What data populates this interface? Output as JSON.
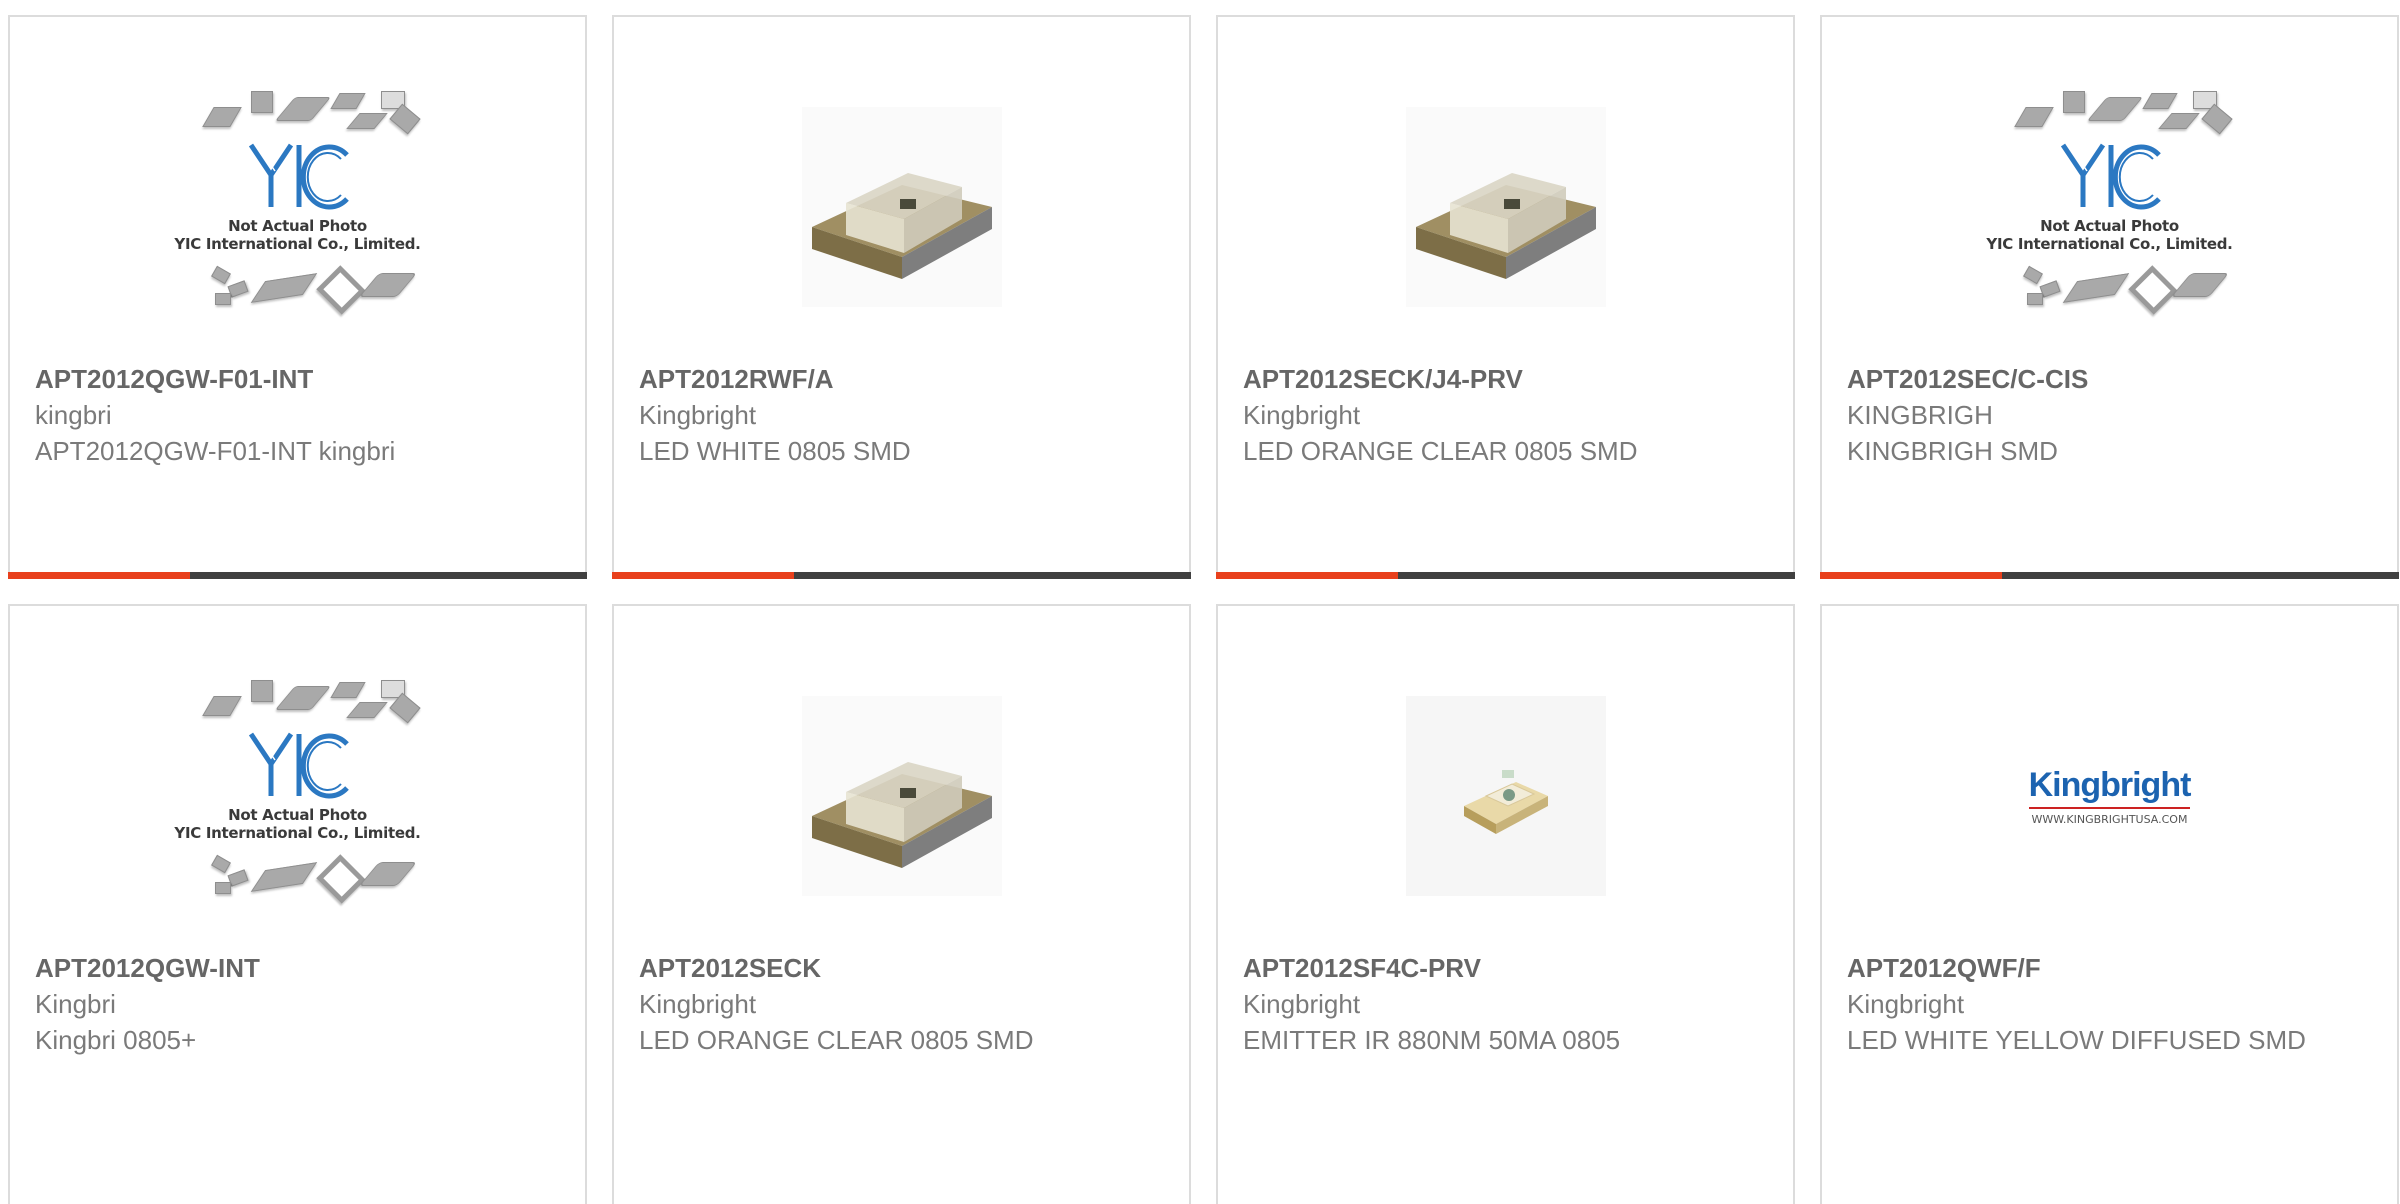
{
  "products": [
    {
      "part_number": "APT2012QGW-F01-INT",
      "manufacturer": "kingbri",
      "description": "APT2012QGW-F01-INT kingbri",
      "image": "yic-placeholder",
      "image_caption_line1": "Not Actual Photo",
      "image_caption_line2": "YIC International Co., Limited."
    },
    {
      "part_number": "APT2012RWF/A",
      "manufacturer": "Kingbright",
      "description": "LED WHITE 0805 SMD",
      "image": "smd-led-clear"
    },
    {
      "part_number": "APT2012SECK/J4-PRV",
      "manufacturer": "Kingbright",
      "description": "LED ORANGE CLEAR 0805 SMD",
      "image": "smd-led-clear"
    },
    {
      "part_number": "APT2012SEC/C-CIS",
      "manufacturer": "KINGBRIGH",
      "description": "KINGBRIGH SMD",
      "image": "yic-placeholder",
      "image_caption_line1": "Not Actual Photo",
      "image_caption_line2": "YIC International Co., Limited."
    },
    {
      "part_number": "APT2012QGW-INT",
      "manufacturer": "Kingbri",
      "description": "Kingbri 0805+",
      "image": "yic-placeholder",
      "image_caption_line1": "Not Actual Photo",
      "image_caption_line2": "YIC International Co., Limited."
    },
    {
      "part_number": "APT2012SECK",
      "manufacturer": "Kingbright",
      "description": "LED ORANGE CLEAR 0805 SMD",
      "image": "smd-led-clear"
    },
    {
      "part_number": "APT2012SF4C-PRV",
      "manufacturer": "Kingbright",
      "description": "EMITTER IR 880NM 50MA 0805",
      "image": "smd-led-small"
    },
    {
      "part_number": "APT2012QWF/F",
      "manufacturer": "Kingbright",
      "description": "LED WHITE YELLOW DIFFUSED SMD",
      "image": "kingbright-logo",
      "logo_name": "Kingbright",
      "logo_url": "WWW.KINGBRIGHTUSA.COM"
    }
  ],
  "colors": {
    "accent": "#e8401c",
    "bar": "#404040",
    "border": "#dcdcdc",
    "text": "#7a7a7a",
    "title": "#666666"
  }
}
